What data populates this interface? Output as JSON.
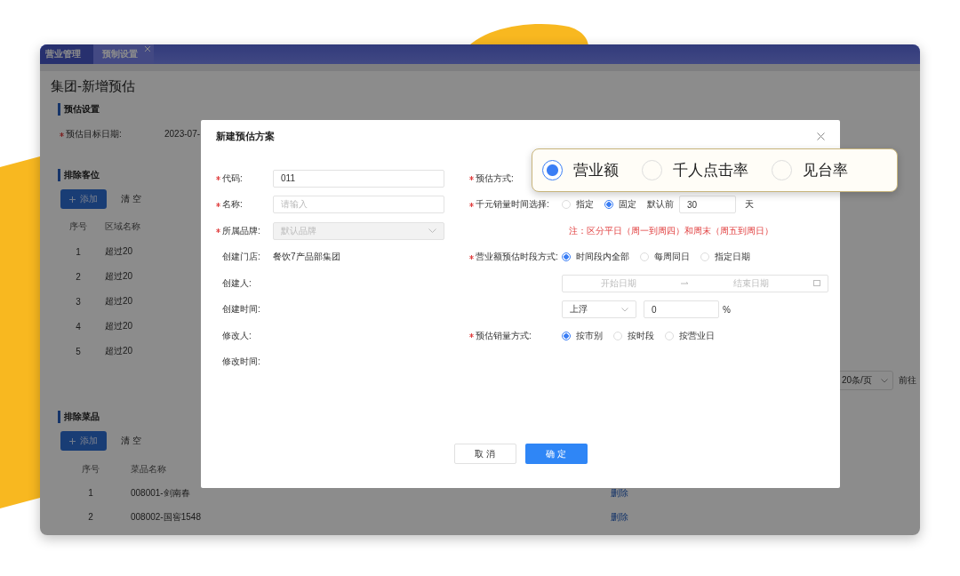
{
  "tabs": [
    {
      "label": "营业管理",
      "selected": false,
      "closable": false
    },
    {
      "label": "预制设置",
      "selected": true,
      "closable": true
    }
  ],
  "page": {
    "title": "集团-新增预估"
  },
  "forecast_settings": {
    "heading": "预估设置",
    "field": {
      "label": "预估目标日期:",
      "required": true,
      "value": "2023-07-"
    }
  },
  "excluded_areas": {
    "heading": "排除客位",
    "add_button": "添加",
    "clear_button": "清 空",
    "columns": [
      "序号",
      "区域名称"
    ],
    "rows": [
      [
        "1",
        "超过20"
      ],
      [
        "2",
        "超过20"
      ],
      [
        "3",
        "超过20"
      ],
      [
        "4",
        "超过20"
      ],
      [
        "5",
        "超过20"
      ]
    ],
    "pagination": {
      "page_size": "20条/页",
      "goto": "前往"
    }
  },
  "excluded_dishes": {
    "heading": "排除菜品",
    "add_button": "添加",
    "clear_button": "清 空",
    "columns": [
      "序号",
      "菜品名称"
    ],
    "rows": [
      {
        "cells": [
          "1",
          "008001-剑南春"
        ],
        "action": "删除"
      },
      {
        "cells": [
          "2",
          "008002-国窖1548"
        ],
        "action": "删除"
      }
    ]
  },
  "dialog": {
    "title": "新建预估方案",
    "left_fields": [
      {
        "kind": "input",
        "label": "代码:",
        "required": true,
        "value": "011"
      },
      {
        "kind": "input",
        "label": "名称:",
        "required": true,
        "placeholder": "请输入"
      },
      {
        "kind": "select",
        "label": "所属品牌:",
        "required": true,
        "placeholder": "默认品牌",
        "disabled": true
      },
      {
        "kind": "text",
        "label": "创建门店:",
        "required": false,
        "value": "餐饮7产品部集团"
      },
      {
        "kind": "text",
        "label": "创建人:",
        "required": false
      },
      {
        "kind": "text",
        "label": "创建时间:",
        "required": false
      },
      {
        "kind": "text",
        "label": "修改人:",
        "required": false
      },
      {
        "kind": "text",
        "label": "修改时间:",
        "required": false
      }
    ],
    "right_fields": [
      {
        "kind": "blank",
        "label": "预估方式:",
        "required": true
      },
      {
        "kind": "radios_days",
        "label": "千元销量时间选择:",
        "required": true,
        "options": [
          {
            "label": "指定",
            "selected": false
          },
          {
            "label": "固定",
            "selected": true
          }
        ],
        "prefix": "默认前",
        "value": "30",
        "suffix": "天"
      },
      {
        "kind": "note",
        "text": "注：区分平日（周一到周四）和周末（周五到周日）"
      },
      {
        "kind": "radios",
        "label": "营业额预估时段方式:",
        "required": true,
        "options": [
          {
            "label": "时间段内全部",
            "selected": true
          },
          {
            "label": "每周同日",
            "selected": false
          },
          {
            "label": "指定日期",
            "selected": false
          }
        ]
      },
      {
        "kind": "date_range",
        "start_placeholder": "开始日期",
        "end_placeholder": "结束日期"
      },
      {
        "kind": "adjust",
        "select_value": "上浮",
        "value": "0",
        "suffix": "%"
      },
      {
        "kind": "radios",
        "label": "预估销量方式:",
        "required": true,
        "options": [
          {
            "label": "按市别",
            "selected": true
          },
          {
            "label": "按时段",
            "selected": false
          },
          {
            "label": "按营业日",
            "selected": false
          }
        ]
      }
    ],
    "buttons": {
      "cancel": "取 消",
      "confirm": "确 定"
    }
  },
  "callout": {
    "options": [
      {
        "label": "营业额",
        "selected": true
      },
      {
        "label": "千人点击率",
        "selected": false
      },
      {
        "label": "见台率",
        "selected": false
      }
    ]
  }
}
